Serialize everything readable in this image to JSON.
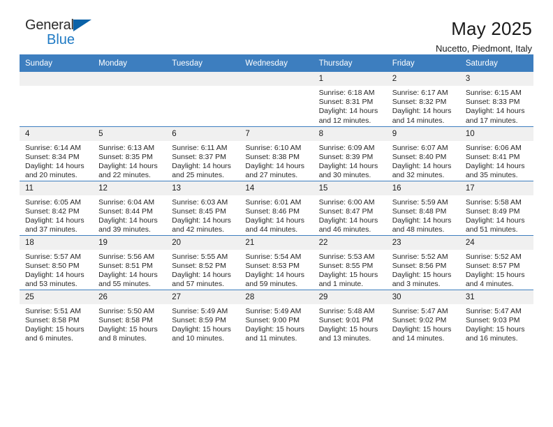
{
  "brand": {
    "line1": "General",
    "line2": "Blue",
    "triangle_icon": "blue-triangle-logo-mark",
    "accent_color": "#1f7ac4",
    "mark_color": "#0a62a8"
  },
  "header": {
    "title": "May 2025",
    "subtitle": "Nucetto, Piedmont, Italy"
  },
  "colors": {
    "header_row": "#3d7ebf",
    "daynum_band": "#f0f0f0",
    "rule": "#3d7ebf"
  },
  "weekday_headers": [
    "Sunday",
    "Monday",
    "Tuesday",
    "Wednesday",
    "Thursday",
    "Friday",
    "Saturday"
  ],
  "weeks": [
    [
      {
        "day": "",
        "sunrise": "",
        "sunset": "",
        "daylight": ""
      },
      {
        "day": "",
        "sunrise": "",
        "sunset": "",
        "daylight": ""
      },
      {
        "day": "",
        "sunrise": "",
        "sunset": "",
        "daylight": ""
      },
      {
        "day": "",
        "sunrise": "",
        "sunset": "",
        "daylight": ""
      },
      {
        "day": "1",
        "sunrise": "Sunrise: 6:18 AM",
        "sunset": "Sunset: 8:31 PM",
        "daylight": "Daylight: 14 hours and 12 minutes."
      },
      {
        "day": "2",
        "sunrise": "Sunrise: 6:17 AM",
        "sunset": "Sunset: 8:32 PM",
        "daylight": "Daylight: 14 hours and 14 minutes."
      },
      {
        "day": "3",
        "sunrise": "Sunrise: 6:15 AM",
        "sunset": "Sunset: 8:33 PM",
        "daylight": "Daylight: 14 hours and 17 minutes."
      }
    ],
    [
      {
        "day": "4",
        "sunrise": "Sunrise: 6:14 AM",
        "sunset": "Sunset: 8:34 PM",
        "daylight": "Daylight: 14 hours and 20 minutes."
      },
      {
        "day": "5",
        "sunrise": "Sunrise: 6:13 AM",
        "sunset": "Sunset: 8:35 PM",
        "daylight": "Daylight: 14 hours and 22 minutes."
      },
      {
        "day": "6",
        "sunrise": "Sunrise: 6:11 AM",
        "sunset": "Sunset: 8:37 PM",
        "daylight": "Daylight: 14 hours and 25 minutes."
      },
      {
        "day": "7",
        "sunrise": "Sunrise: 6:10 AM",
        "sunset": "Sunset: 8:38 PM",
        "daylight": "Daylight: 14 hours and 27 minutes."
      },
      {
        "day": "8",
        "sunrise": "Sunrise: 6:09 AM",
        "sunset": "Sunset: 8:39 PM",
        "daylight": "Daylight: 14 hours and 30 minutes."
      },
      {
        "day": "9",
        "sunrise": "Sunrise: 6:07 AM",
        "sunset": "Sunset: 8:40 PM",
        "daylight": "Daylight: 14 hours and 32 minutes."
      },
      {
        "day": "10",
        "sunrise": "Sunrise: 6:06 AM",
        "sunset": "Sunset: 8:41 PM",
        "daylight": "Daylight: 14 hours and 35 minutes."
      }
    ],
    [
      {
        "day": "11",
        "sunrise": "Sunrise: 6:05 AM",
        "sunset": "Sunset: 8:42 PM",
        "daylight": "Daylight: 14 hours and 37 minutes."
      },
      {
        "day": "12",
        "sunrise": "Sunrise: 6:04 AM",
        "sunset": "Sunset: 8:44 PM",
        "daylight": "Daylight: 14 hours and 39 minutes."
      },
      {
        "day": "13",
        "sunrise": "Sunrise: 6:03 AM",
        "sunset": "Sunset: 8:45 PM",
        "daylight": "Daylight: 14 hours and 42 minutes."
      },
      {
        "day": "14",
        "sunrise": "Sunrise: 6:01 AM",
        "sunset": "Sunset: 8:46 PM",
        "daylight": "Daylight: 14 hours and 44 minutes."
      },
      {
        "day": "15",
        "sunrise": "Sunrise: 6:00 AM",
        "sunset": "Sunset: 8:47 PM",
        "daylight": "Daylight: 14 hours and 46 minutes."
      },
      {
        "day": "16",
        "sunrise": "Sunrise: 5:59 AM",
        "sunset": "Sunset: 8:48 PM",
        "daylight": "Daylight: 14 hours and 48 minutes."
      },
      {
        "day": "17",
        "sunrise": "Sunrise: 5:58 AM",
        "sunset": "Sunset: 8:49 PM",
        "daylight": "Daylight: 14 hours and 51 minutes."
      }
    ],
    [
      {
        "day": "18",
        "sunrise": "Sunrise: 5:57 AM",
        "sunset": "Sunset: 8:50 PM",
        "daylight": "Daylight: 14 hours and 53 minutes."
      },
      {
        "day": "19",
        "sunrise": "Sunrise: 5:56 AM",
        "sunset": "Sunset: 8:51 PM",
        "daylight": "Daylight: 14 hours and 55 minutes."
      },
      {
        "day": "20",
        "sunrise": "Sunrise: 5:55 AM",
        "sunset": "Sunset: 8:52 PM",
        "daylight": "Daylight: 14 hours and 57 minutes."
      },
      {
        "day": "21",
        "sunrise": "Sunrise: 5:54 AM",
        "sunset": "Sunset: 8:53 PM",
        "daylight": "Daylight: 14 hours and 59 minutes."
      },
      {
        "day": "22",
        "sunrise": "Sunrise: 5:53 AM",
        "sunset": "Sunset: 8:55 PM",
        "daylight": "Daylight: 15 hours and 1 minute."
      },
      {
        "day": "23",
        "sunrise": "Sunrise: 5:52 AM",
        "sunset": "Sunset: 8:56 PM",
        "daylight": "Daylight: 15 hours and 3 minutes."
      },
      {
        "day": "24",
        "sunrise": "Sunrise: 5:52 AM",
        "sunset": "Sunset: 8:57 PM",
        "daylight": "Daylight: 15 hours and 4 minutes."
      }
    ],
    [
      {
        "day": "25",
        "sunrise": "Sunrise: 5:51 AM",
        "sunset": "Sunset: 8:58 PM",
        "daylight": "Daylight: 15 hours and 6 minutes."
      },
      {
        "day": "26",
        "sunrise": "Sunrise: 5:50 AM",
        "sunset": "Sunset: 8:58 PM",
        "daylight": "Daylight: 15 hours and 8 minutes."
      },
      {
        "day": "27",
        "sunrise": "Sunrise: 5:49 AM",
        "sunset": "Sunset: 8:59 PM",
        "daylight": "Daylight: 15 hours and 10 minutes."
      },
      {
        "day": "28",
        "sunrise": "Sunrise: 5:49 AM",
        "sunset": "Sunset: 9:00 PM",
        "daylight": "Daylight: 15 hours and 11 minutes."
      },
      {
        "day": "29",
        "sunrise": "Sunrise: 5:48 AM",
        "sunset": "Sunset: 9:01 PM",
        "daylight": "Daylight: 15 hours and 13 minutes."
      },
      {
        "day": "30",
        "sunrise": "Sunrise: 5:47 AM",
        "sunset": "Sunset: 9:02 PM",
        "daylight": "Daylight: 15 hours and 14 minutes."
      },
      {
        "day": "31",
        "sunrise": "Sunrise: 5:47 AM",
        "sunset": "Sunset: 9:03 PM",
        "daylight": "Daylight: 15 hours and 16 minutes."
      }
    ]
  ]
}
